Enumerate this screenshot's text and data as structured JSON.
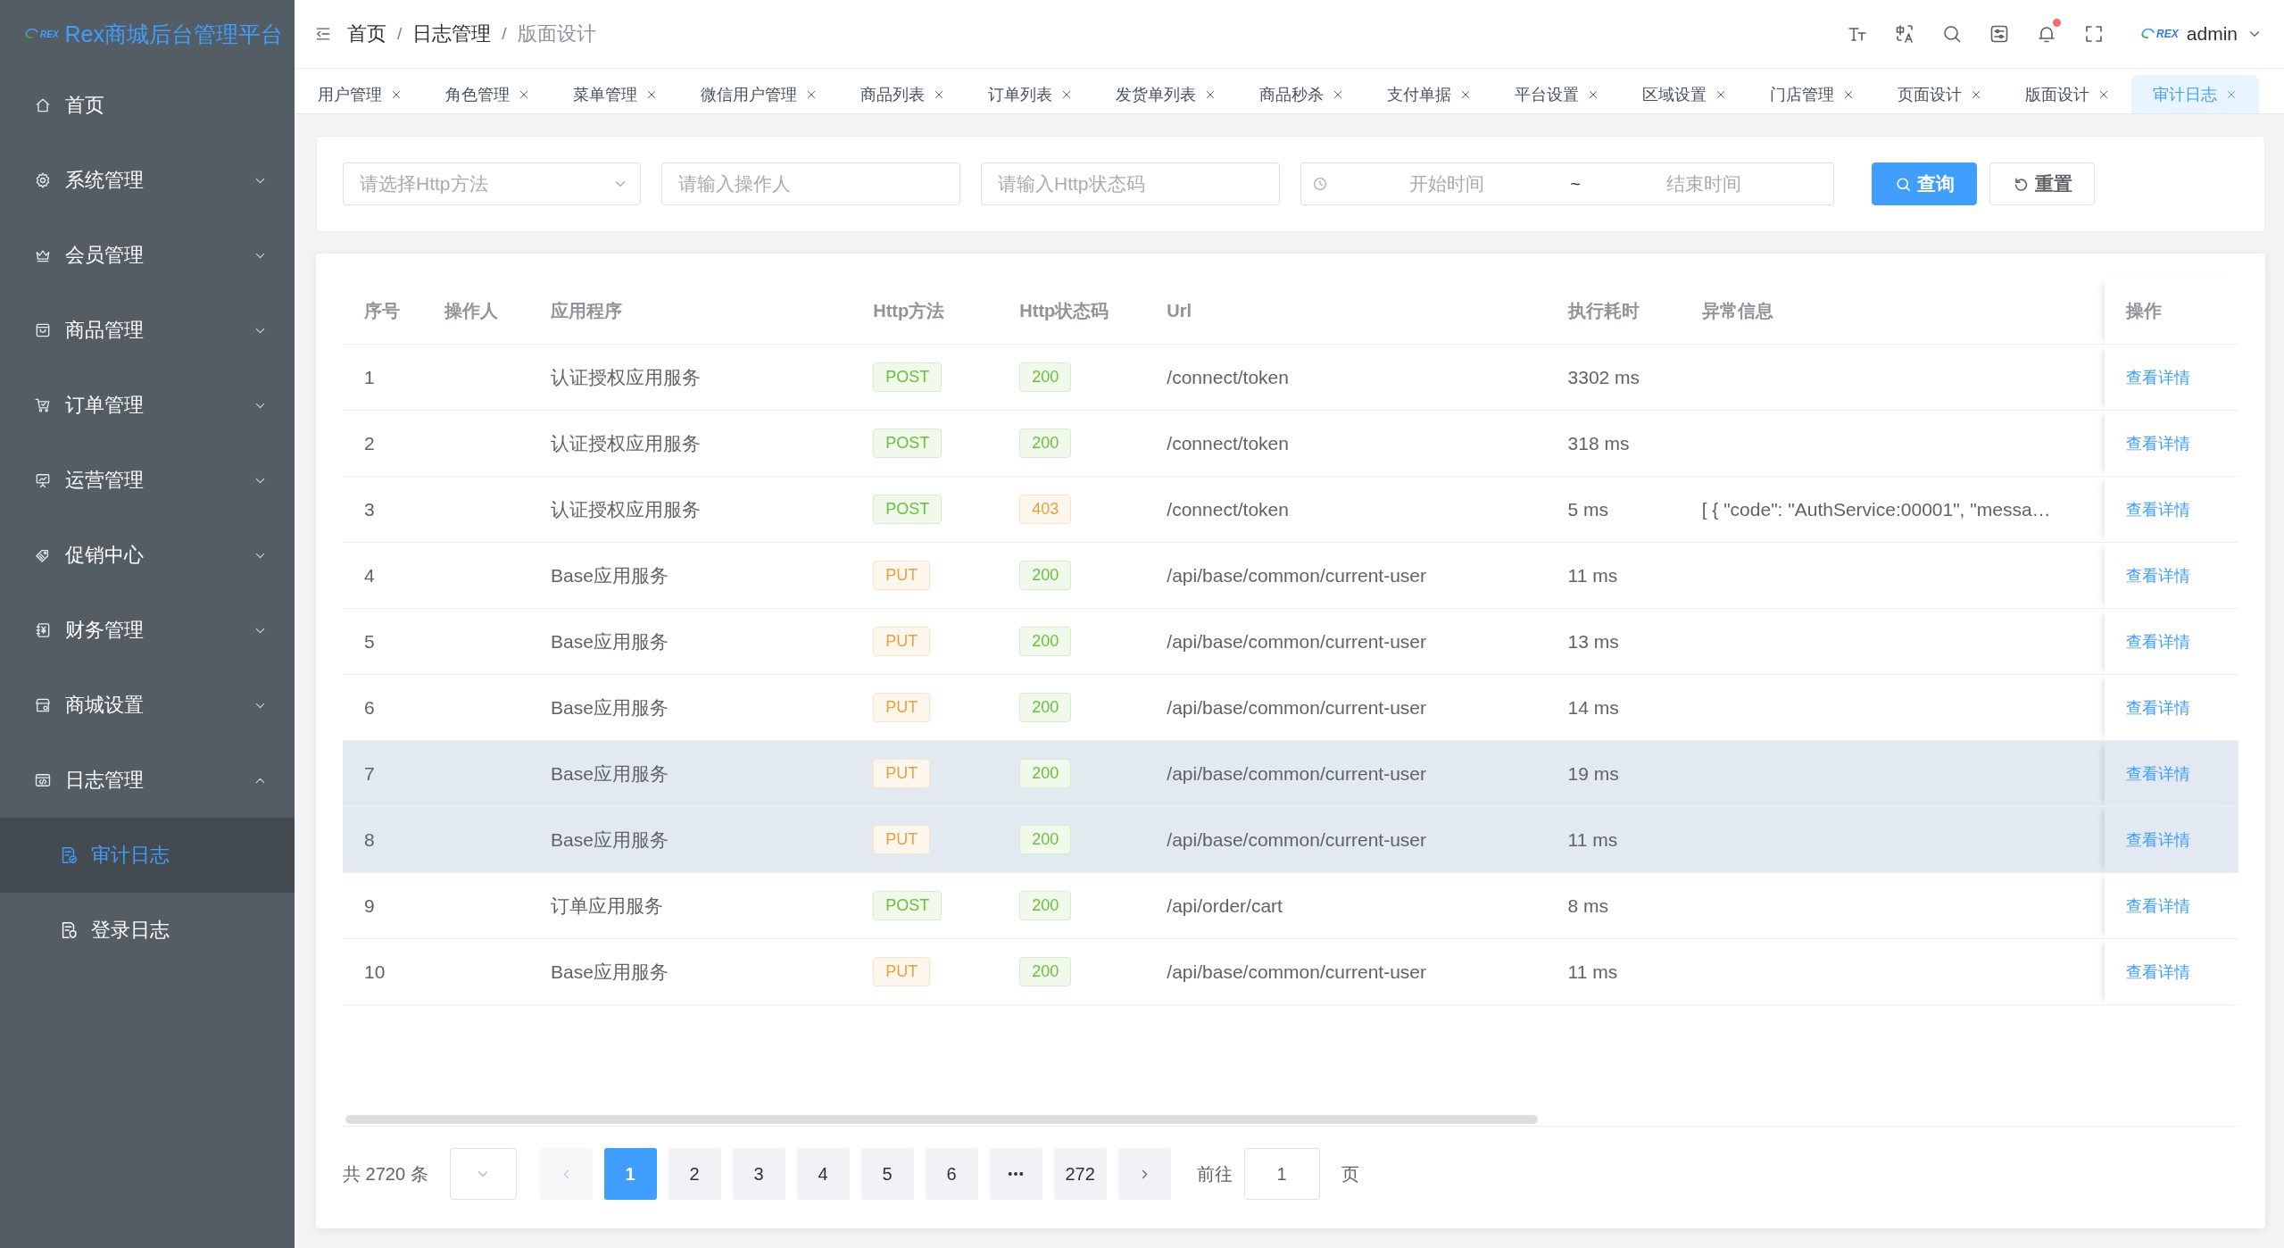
{
  "sidebar": {
    "logo_mark": "REX",
    "title": "Rex商城后台管理平台",
    "items": [
      {
        "label": "首页",
        "kind": "link",
        "selected": false
      },
      {
        "label": "系统管理",
        "kind": "group",
        "expanded": false
      },
      {
        "label": "会员管理",
        "kind": "group",
        "expanded": false
      },
      {
        "label": "商品管理",
        "kind": "group",
        "expanded": false
      },
      {
        "label": "订单管理",
        "kind": "group",
        "expanded": false
      },
      {
        "label": "运营管理",
        "kind": "group",
        "expanded": false
      },
      {
        "label": "促销中心",
        "kind": "group",
        "expanded": false
      },
      {
        "label": "财务管理",
        "kind": "group",
        "expanded": false
      },
      {
        "label": "商城设置",
        "kind": "group",
        "expanded": false
      },
      {
        "label": "日志管理",
        "kind": "group",
        "expanded": true,
        "children": [
          {
            "label": "审计日志",
            "selected": true
          },
          {
            "label": "登录日志",
            "selected": false
          }
        ]
      }
    ]
  },
  "header": {
    "breadcrumb": {
      "separator": "/",
      "items": [
        "首页",
        "日志管理",
        "版面设计"
      ]
    },
    "notifications": {
      "unread": true
    },
    "user": {
      "avatar_mark": "REX",
      "name": "admin"
    }
  },
  "tabs": [
    {
      "label": "用户管理",
      "selected": false
    },
    {
      "label": "角色管理",
      "selected": false
    },
    {
      "label": "菜单管理",
      "selected": false
    },
    {
      "label": "微信用户管理",
      "selected": false
    },
    {
      "label": "商品列表",
      "selected": false
    },
    {
      "label": "订单列表",
      "selected": false
    },
    {
      "label": "发货单列表",
      "selected": false
    },
    {
      "label": "商品秒杀",
      "selected": false
    },
    {
      "label": "支付单据",
      "selected": false
    },
    {
      "label": "平台设置",
      "selected": false
    },
    {
      "label": "区域设置",
      "selected": false
    },
    {
      "label": "门店管理",
      "selected": false
    },
    {
      "label": "页面设计",
      "selected": false
    },
    {
      "label": "版面设计",
      "selected": false
    },
    {
      "label": "审计日志",
      "selected": true
    }
  ],
  "filters": {
    "method": {
      "placeholder": "请选择Http方法"
    },
    "operator": {
      "placeholder": "请输入操作人"
    },
    "status_code": {
      "placeholder": "请输入Http状态码"
    },
    "time_range": {
      "start_placeholder": "开始时间",
      "separator": "~",
      "end_placeholder": "结束时间"
    },
    "buttons": [
      {
        "kind": "primary",
        "label": "查询"
      },
      {
        "kind": "default",
        "label": "重置"
      }
    ]
  },
  "table": {
    "columns": [
      "序号",
      "操作人",
      "应用程序",
      "Http方法",
      "Http状态码",
      "Url",
      "执行耗时",
      "异常信息",
      "操作"
    ],
    "rows": [
      {
        "index": "1",
        "app": "认证授权应用服务",
        "method": {
          "text": "POST",
          "color": "#67c23a"
        },
        "status": {
          "text": "200",
          "color": "#67c23a"
        },
        "url": "/connect/token",
        "duration": "3302 ms",
        "action": "查看详情",
        "highlighted": false
      },
      {
        "index": "2",
        "app": "认证授权应用服务",
        "method": {
          "text": "POST",
          "color": "#67c23a"
        },
        "status": {
          "text": "200",
          "color": "#67c23a"
        },
        "url": "/connect/token",
        "duration": "318 ms",
        "action": "查看详情",
        "highlighted": false
      },
      {
        "index": "3",
        "app": "认证授权应用服务",
        "method": {
          "text": "POST",
          "color": "#67c23a"
        },
        "status": {
          "text": "403",
          "color": "#e6a23c"
        },
        "url": "/connect/token",
        "duration": "5 ms",
        "exception": "[ { \"code\": \"AuthService:00001\", \"messa…",
        "action": "查看详情",
        "highlighted": false
      },
      {
        "index": "4",
        "app": "Base应用服务",
        "method": {
          "text": "PUT",
          "color": "#e6a23c"
        },
        "status": {
          "text": "200",
          "color": "#67c23a"
        },
        "url": "/api/base/common/current-user",
        "duration": "11 ms",
        "action": "查看详情",
        "highlighted": false
      },
      {
        "index": "5",
        "app": "Base应用服务",
        "method": {
          "text": "PUT",
          "color": "#e6a23c"
        },
        "status": {
          "text": "200",
          "color": "#67c23a"
        },
        "url": "/api/base/common/current-user",
        "duration": "13 ms",
        "action": "查看详情",
        "highlighted": false
      },
      {
        "index": "6",
        "app": "Base应用服务",
        "method": {
          "text": "PUT",
          "color": "#e6a23c"
        },
        "status": {
          "text": "200",
          "color": "#67c23a"
        },
        "url": "/api/base/common/current-user",
        "duration": "14 ms",
        "action": "查看详情",
        "highlighted": false
      },
      {
        "index": "7",
        "app": "Base应用服务",
        "method": {
          "text": "PUT",
          "color": "#e6a23c"
        },
        "status": {
          "text": "200",
          "color": "#67c23a"
        },
        "url": "/api/base/common/current-user",
        "duration": "19 ms",
        "action": "查看详情",
        "highlighted": true
      },
      {
        "index": "8",
        "app": "Base应用服务",
        "method": {
          "text": "PUT",
          "color": "#e6a23c"
        },
        "status": {
          "text": "200",
          "color": "#67c23a"
        },
        "url": "/api/base/common/current-user",
        "duration": "11 ms",
        "action": "查看详情",
        "highlighted": true
      },
      {
        "index": "9",
        "app": "订单应用服务",
        "method": {
          "text": "POST",
          "color": "#67c23a"
        },
        "status": {
          "text": "200",
          "color": "#67c23a"
        },
        "url": "/api/order/cart",
        "duration": "8 ms",
        "action": "查看详情",
        "highlighted": false
      },
      {
        "index": "10",
        "app": "Base应用服务",
        "method": {
          "text": "PUT",
          "color": "#e6a23c"
        },
        "status": {
          "text": "200",
          "color": "#67c23a"
        },
        "url": "/api/base/common/current-user",
        "duration": "11 ms",
        "action": "查看详情",
        "highlighted": false
      }
    ]
  },
  "pagination": {
    "total": "共 2720 条",
    "prev": {
      "disabled": true
    },
    "pages": [
      {
        "kind": "page",
        "label": "1",
        "selected": true
      },
      {
        "kind": "page",
        "label": "2",
        "selected": false
      },
      {
        "kind": "page",
        "label": "3",
        "selected": false
      },
      {
        "kind": "page",
        "label": "4",
        "selected": false
      },
      {
        "kind": "page",
        "label": "5",
        "selected": false
      },
      {
        "kind": "page",
        "label": "6",
        "selected": false
      },
      {
        "kind": "more",
        "selected": false
      },
      {
        "kind": "page",
        "label": "272",
        "selected": false
      }
    ],
    "next": {
      "disabled": false
    },
    "jump": {
      "label": "前往",
      "value": "1",
      "unit": "页"
    }
  }
}
